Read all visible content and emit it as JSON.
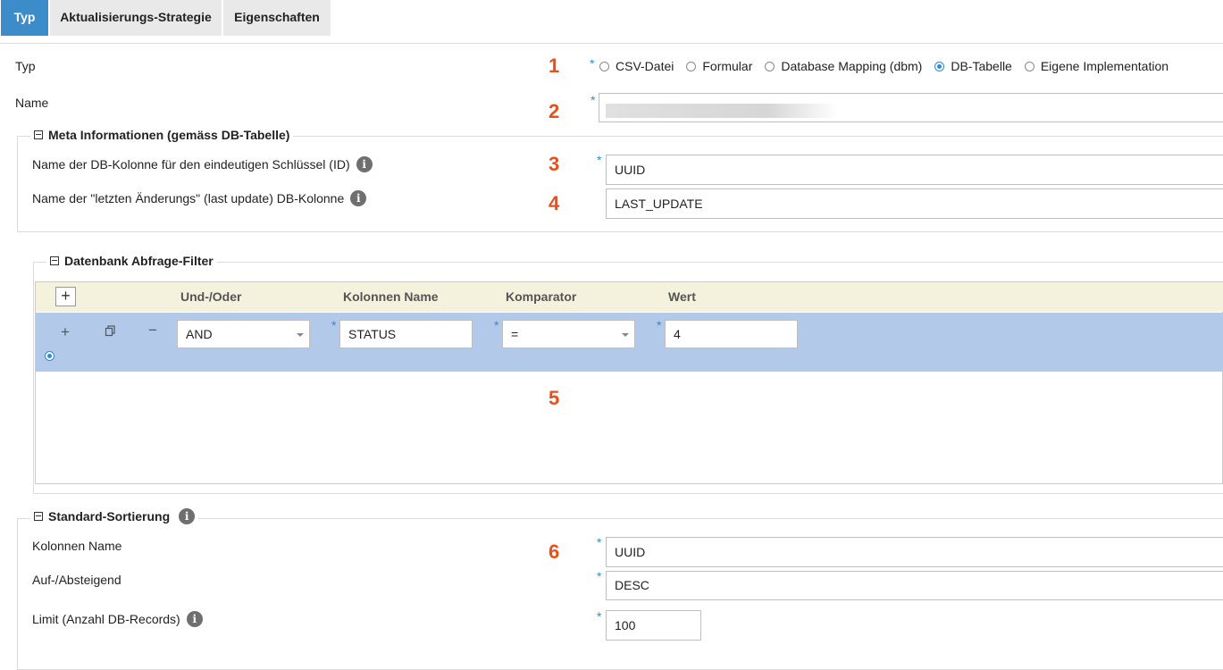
{
  "tabs": [
    {
      "label": "Typ",
      "active": true
    },
    {
      "label": "Aktualisierungs-Strategie",
      "active": false
    },
    {
      "label": "Eigenschaften",
      "active": false
    }
  ],
  "type_field": {
    "label": "Typ",
    "number": "1",
    "options": [
      "CSV-Datei",
      "Formular",
      "Database Mapping (dbm)",
      "DB-Tabelle",
      "Eigene Implementation"
    ],
    "selected": "DB-Tabelle"
  },
  "name_field": {
    "label": "Name",
    "number": "2",
    "value": ""
  },
  "meta": {
    "legend": "Meta Informationen (gemäss DB-Tabelle)",
    "id_label": "Name der DB-Kolonne für den eindeutigen Schlüssel (ID)",
    "id_number": "3",
    "id_value": "UUID",
    "update_label": "Name der \"letzten Änderungs\" (last update) DB-Kolonne",
    "update_number": "4",
    "update_value": "LAST_UPDATE"
  },
  "filter": {
    "legend": "Datenbank Abfrage-Filter",
    "add_symbol": "+",
    "headers": {
      "andor": "Und-/Oder",
      "column": "Kolonnen Name",
      "comparator": "Komparator",
      "value": "Wert"
    },
    "row": {
      "andor": "AND",
      "column": "STATUS",
      "comparator": "=",
      "value": "4"
    },
    "number": "5"
  },
  "sort": {
    "legend": "Standard-Sortierung",
    "column_label": "Kolonnen Name",
    "column_number": "6",
    "column_value": "UUID",
    "order_label": "Auf-/Absteigend",
    "order_value": "DESC",
    "limit_label": "Limit (Anzahl DB-Records)",
    "limit_value": "100"
  },
  "required_mark": "*",
  "info_glyph": "i",
  "colors": {
    "accent": "#3c8cc9",
    "number": "#e8501b",
    "row_selected": "#b2c9ea",
    "header_bg": "#f4f2dd",
    "required": "#2e8bd6"
  }
}
